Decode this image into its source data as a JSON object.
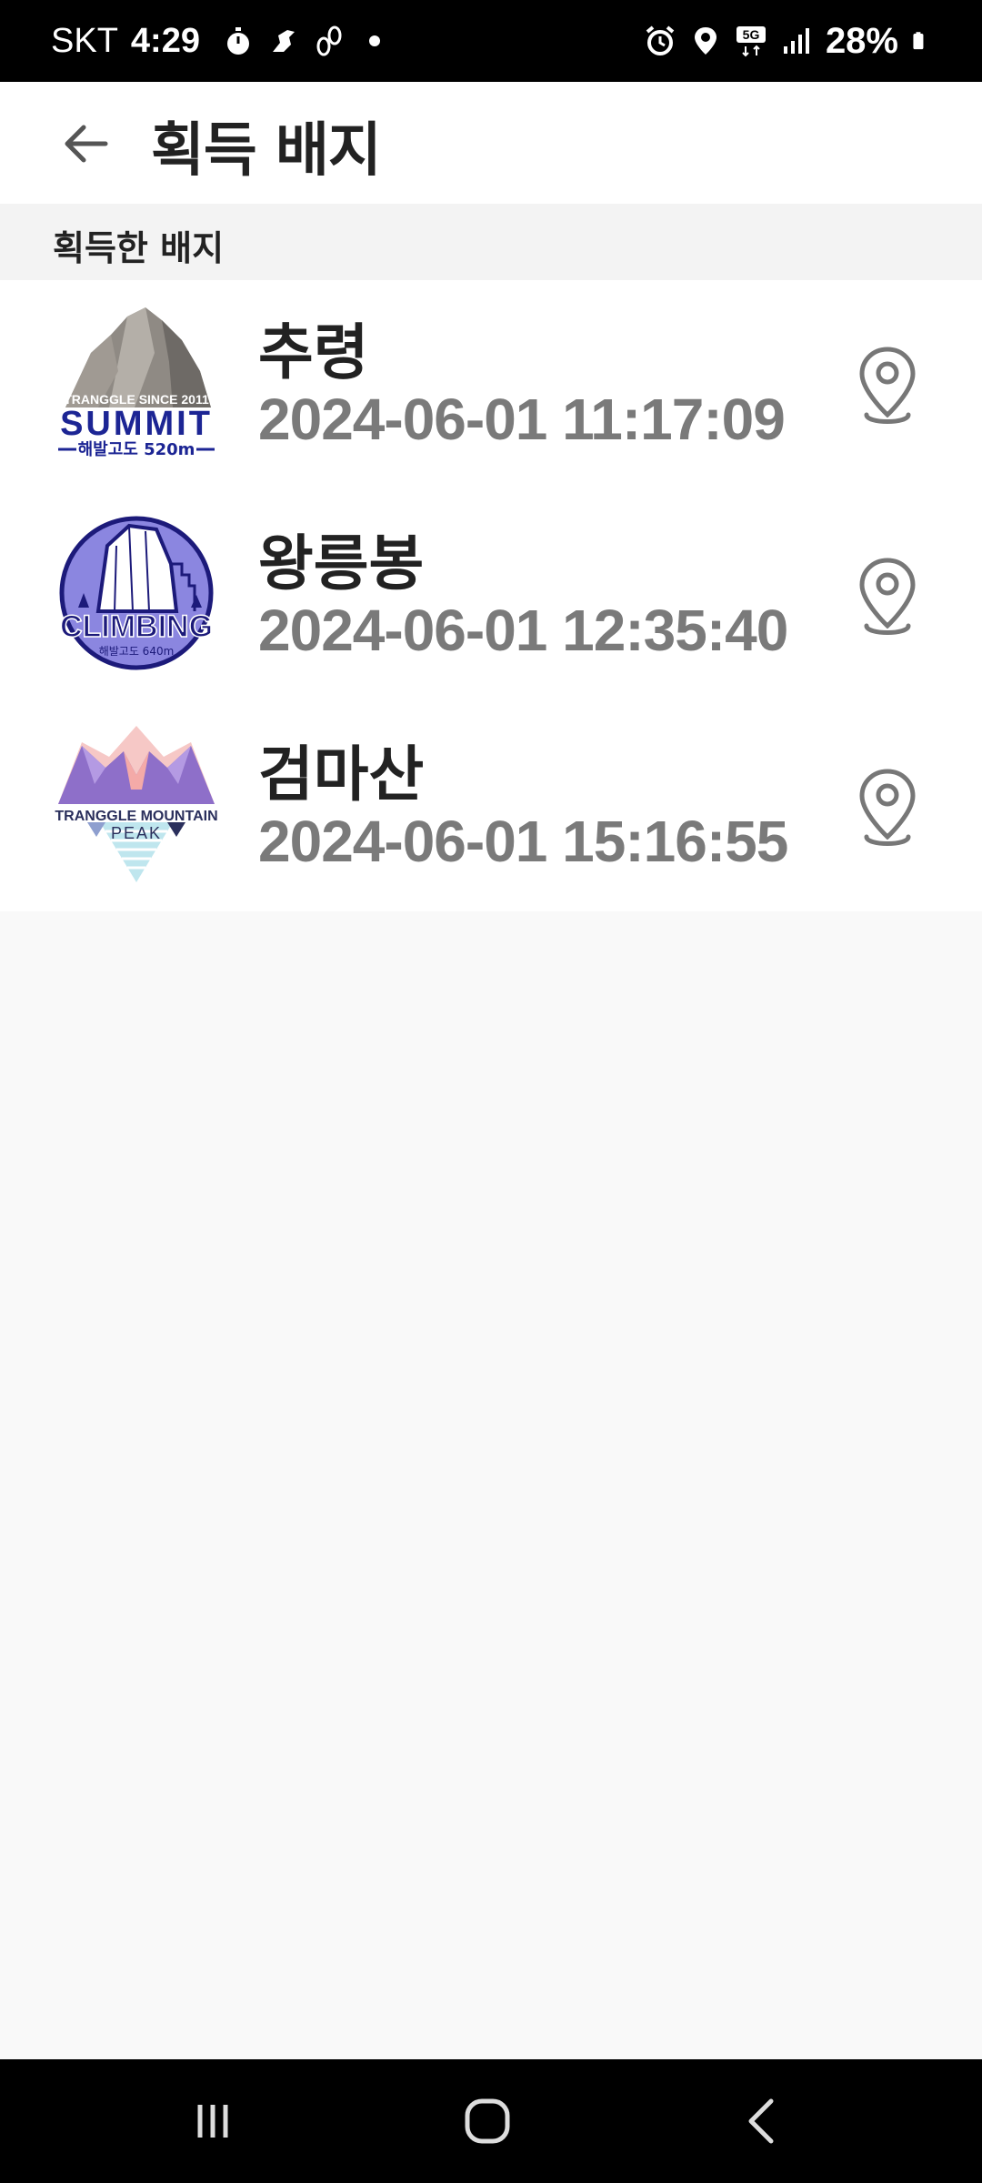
{
  "status_bar": {
    "carrier": "SKT",
    "time": "4:29",
    "battery": "28%",
    "network": "5G",
    "left_icons": [
      "stopwatch-icon",
      "runner-icon",
      "footprints-icon",
      "dot-icon"
    ],
    "right_icons": [
      "alarm-icon",
      "location-icon",
      "5g-icon",
      "signal-icon",
      "battery-icon"
    ]
  },
  "app_bar": {
    "title": "획득 배지",
    "back_icon": "arrow-left-icon"
  },
  "section": {
    "title": "획득한 배지"
  },
  "badges": [
    {
      "name": "추령",
      "date": "2024-06-01 11:17:09",
      "badge_type": "summit",
      "badge_text_top": "TRANGGLE SINCE 2011",
      "badge_text_main": "SUMMIT",
      "badge_text_sub": "해발고도 520m",
      "colors": {
        "rock": "#8f8a84",
        "text": "#1c2594"
      }
    },
    {
      "name": "왕릉봉",
      "date": "2024-06-01 12:35:40",
      "badge_type": "climbing",
      "badge_text_main": "CLIMBING",
      "badge_text_sub": "해발고도 640m",
      "colors": {
        "circle": "#8b86e0",
        "text": "#1c1a7a"
      }
    },
    {
      "name": "검마산",
      "date": "2024-06-01 15:16:55",
      "badge_type": "peak",
      "badge_text_main": "TRANGGLE MOUNTAIN",
      "badge_text_sub": "PEAK",
      "colors": {
        "mountain": "#8e6fc9",
        "pink": "#f4aaa8",
        "text": "#2a2f5c"
      }
    }
  ],
  "nav_bar": {
    "icons": [
      "recents-icon",
      "home-icon",
      "back-icon"
    ]
  }
}
